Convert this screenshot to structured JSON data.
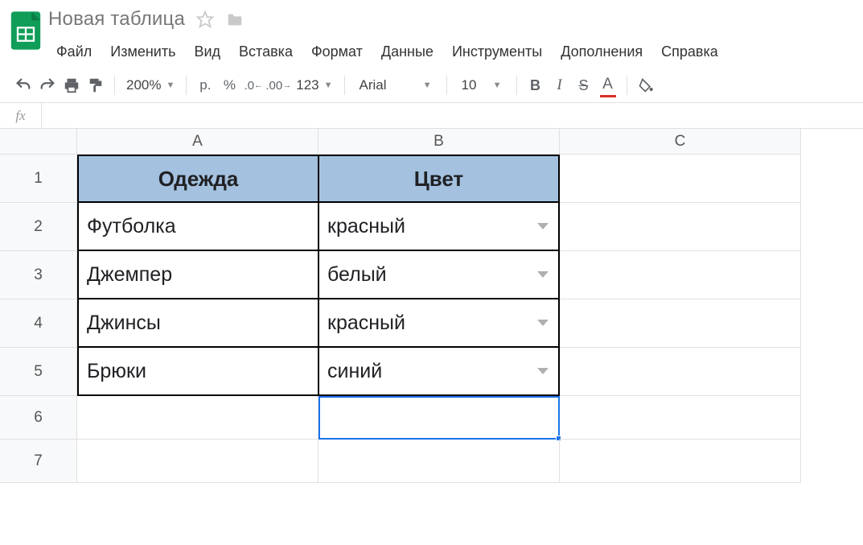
{
  "title": "Новая таблица",
  "menu": [
    "Файл",
    "Изменить",
    "Вид",
    "Вставка",
    "Формат",
    "Данные",
    "Инструменты",
    "Дополнения",
    "Справка"
  ],
  "toolbar": {
    "zoom": "200%",
    "currency": "р.",
    "percent": "%",
    "dec_less": ".0",
    "dec_more": ".00",
    "format123": "123",
    "font": "Arial",
    "size": "10",
    "bold": "B",
    "italic": "I",
    "strike": "S",
    "textcolor": "A"
  },
  "columns": [
    "A",
    "B",
    "C"
  ],
  "rownums": [
    "1",
    "2",
    "3",
    "4",
    "5",
    "6",
    "7"
  ],
  "sheet": {
    "headers": {
      "A": "Одежда",
      "B": "Цвет"
    },
    "rows": [
      {
        "A": "Футболка",
        "B": "красный"
      },
      {
        "A": "Джемпер",
        "B": "белый"
      },
      {
        "A": "Джинсы",
        "B": "красный"
      },
      {
        "A": "Брюки",
        "B": "синий"
      }
    ]
  }
}
